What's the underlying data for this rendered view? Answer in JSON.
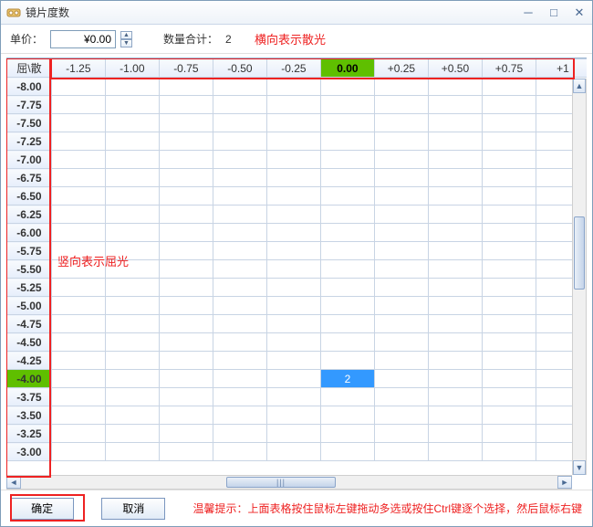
{
  "window": {
    "title": "镜片度数"
  },
  "toolbar": {
    "price_label": "单价：",
    "price_value": "¥0.00",
    "qty_label": "数量合计：",
    "qty_value": "2"
  },
  "annotations": {
    "horiz": "横向表示散光",
    "vert": "竖向表示屈光"
  },
  "grid": {
    "corner": "屈\\散",
    "cols": [
      "-1.25",
      "-1.00",
      "-0.75",
      "-0.50",
      "-0.25",
      "0.00",
      "+0.25",
      "+0.50",
      "+0.75",
      "+1"
    ],
    "rows": [
      "-8.00",
      "-7.75",
      "-7.50",
      "-7.25",
      "-7.00",
      "-6.75",
      "-6.50",
      "-6.25",
      "-6.00",
      "-5.75",
      "-5.50",
      "-5.25",
      "-5.00",
      "-4.75",
      "-4.50",
      "-4.25",
      "-4.00",
      "-3.75",
      "-3.50",
      "-3.25",
      "-3.00"
    ],
    "highlight_col_index": 5,
    "highlight_row_index": 16,
    "selected_cell": {
      "row": 16,
      "col": 5,
      "value": "2"
    }
  },
  "footer": {
    "ok": "确定",
    "cancel": "取消",
    "tip": "温馨提示：上面表格按住鼠标左键拖动多选或按住Ctrl键逐个选择，然后鼠标右键可"
  }
}
